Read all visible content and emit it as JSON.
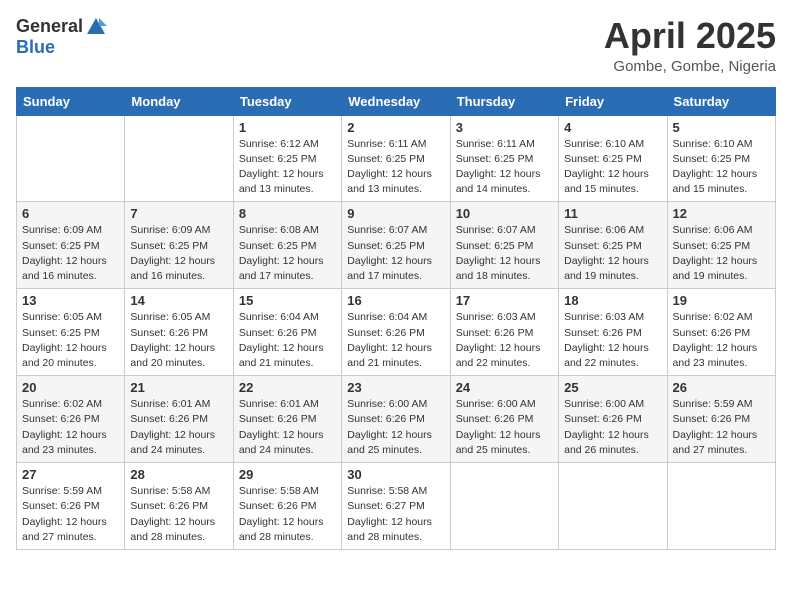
{
  "header": {
    "logo_general": "General",
    "logo_blue": "Blue",
    "title": "April 2025",
    "location": "Gombe, Gombe, Nigeria"
  },
  "calendar": {
    "days_of_week": [
      "Sunday",
      "Monday",
      "Tuesday",
      "Wednesday",
      "Thursday",
      "Friday",
      "Saturday"
    ],
    "weeks": [
      [
        {
          "day": "",
          "info": ""
        },
        {
          "day": "",
          "info": ""
        },
        {
          "day": "1",
          "info": "Sunrise: 6:12 AM\nSunset: 6:25 PM\nDaylight: 12 hours and 13 minutes."
        },
        {
          "day": "2",
          "info": "Sunrise: 6:11 AM\nSunset: 6:25 PM\nDaylight: 12 hours and 13 minutes."
        },
        {
          "day": "3",
          "info": "Sunrise: 6:11 AM\nSunset: 6:25 PM\nDaylight: 12 hours and 14 minutes."
        },
        {
          "day": "4",
          "info": "Sunrise: 6:10 AM\nSunset: 6:25 PM\nDaylight: 12 hours and 15 minutes."
        },
        {
          "day": "5",
          "info": "Sunrise: 6:10 AM\nSunset: 6:25 PM\nDaylight: 12 hours and 15 minutes."
        }
      ],
      [
        {
          "day": "6",
          "info": "Sunrise: 6:09 AM\nSunset: 6:25 PM\nDaylight: 12 hours and 16 minutes."
        },
        {
          "day": "7",
          "info": "Sunrise: 6:09 AM\nSunset: 6:25 PM\nDaylight: 12 hours and 16 minutes."
        },
        {
          "day": "8",
          "info": "Sunrise: 6:08 AM\nSunset: 6:25 PM\nDaylight: 12 hours and 17 minutes."
        },
        {
          "day": "9",
          "info": "Sunrise: 6:07 AM\nSunset: 6:25 PM\nDaylight: 12 hours and 17 minutes."
        },
        {
          "day": "10",
          "info": "Sunrise: 6:07 AM\nSunset: 6:25 PM\nDaylight: 12 hours and 18 minutes."
        },
        {
          "day": "11",
          "info": "Sunrise: 6:06 AM\nSunset: 6:25 PM\nDaylight: 12 hours and 19 minutes."
        },
        {
          "day": "12",
          "info": "Sunrise: 6:06 AM\nSunset: 6:25 PM\nDaylight: 12 hours and 19 minutes."
        }
      ],
      [
        {
          "day": "13",
          "info": "Sunrise: 6:05 AM\nSunset: 6:25 PM\nDaylight: 12 hours and 20 minutes."
        },
        {
          "day": "14",
          "info": "Sunrise: 6:05 AM\nSunset: 6:26 PM\nDaylight: 12 hours and 20 minutes."
        },
        {
          "day": "15",
          "info": "Sunrise: 6:04 AM\nSunset: 6:26 PM\nDaylight: 12 hours and 21 minutes."
        },
        {
          "day": "16",
          "info": "Sunrise: 6:04 AM\nSunset: 6:26 PM\nDaylight: 12 hours and 21 minutes."
        },
        {
          "day": "17",
          "info": "Sunrise: 6:03 AM\nSunset: 6:26 PM\nDaylight: 12 hours and 22 minutes."
        },
        {
          "day": "18",
          "info": "Sunrise: 6:03 AM\nSunset: 6:26 PM\nDaylight: 12 hours and 22 minutes."
        },
        {
          "day": "19",
          "info": "Sunrise: 6:02 AM\nSunset: 6:26 PM\nDaylight: 12 hours and 23 minutes."
        }
      ],
      [
        {
          "day": "20",
          "info": "Sunrise: 6:02 AM\nSunset: 6:26 PM\nDaylight: 12 hours and 23 minutes."
        },
        {
          "day": "21",
          "info": "Sunrise: 6:01 AM\nSunset: 6:26 PM\nDaylight: 12 hours and 24 minutes."
        },
        {
          "day": "22",
          "info": "Sunrise: 6:01 AM\nSunset: 6:26 PM\nDaylight: 12 hours and 24 minutes."
        },
        {
          "day": "23",
          "info": "Sunrise: 6:00 AM\nSunset: 6:26 PM\nDaylight: 12 hours and 25 minutes."
        },
        {
          "day": "24",
          "info": "Sunrise: 6:00 AM\nSunset: 6:26 PM\nDaylight: 12 hours and 25 minutes."
        },
        {
          "day": "25",
          "info": "Sunrise: 6:00 AM\nSunset: 6:26 PM\nDaylight: 12 hours and 26 minutes."
        },
        {
          "day": "26",
          "info": "Sunrise: 5:59 AM\nSunset: 6:26 PM\nDaylight: 12 hours and 27 minutes."
        }
      ],
      [
        {
          "day": "27",
          "info": "Sunrise: 5:59 AM\nSunset: 6:26 PM\nDaylight: 12 hours and 27 minutes."
        },
        {
          "day": "28",
          "info": "Sunrise: 5:58 AM\nSunset: 6:26 PM\nDaylight: 12 hours and 28 minutes."
        },
        {
          "day": "29",
          "info": "Sunrise: 5:58 AM\nSunset: 6:26 PM\nDaylight: 12 hours and 28 minutes."
        },
        {
          "day": "30",
          "info": "Sunrise: 5:58 AM\nSunset: 6:27 PM\nDaylight: 12 hours and 28 minutes."
        },
        {
          "day": "",
          "info": ""
        },
        {
          "day": "",
          "info": ""
        },
        {
          "day": "",
          "info": ""
        }
      ]
    ]
  }
}
